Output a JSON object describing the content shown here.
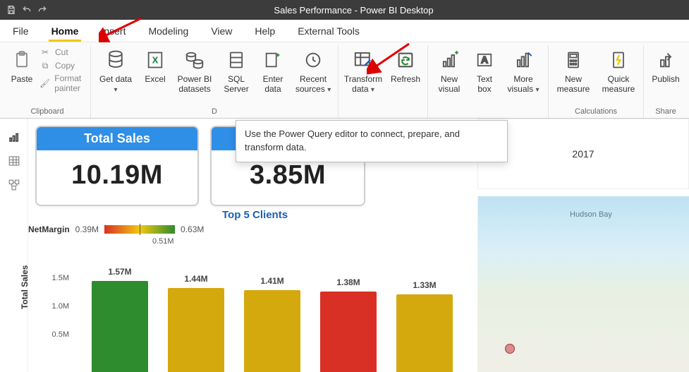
{
  "titlebar": {
    "title": "Sales Performance - Power BI Desktop"
  },
  "tabs": {
    "file": "File",
    "home": "Home",
    "insert": "Insert",
    "modeling": "Modeling",
    "view": "View",
    "help": "Help",
    "external": "External Tools"
  },
  "clipboard": {
    "paste": "Paste",
    "cut": "Cut",
    "copy": "Copy",
    "format_painter": "Format painter",
    "group": "Clipboard"
  },
  "data_group": {
    "get_data": "Get data",
    "excel": "Excel",
    "pbi_datasets": "Power BI datasets",
    "sql": "SQL Server",
    "enter": "Enter data",
    "recent": "Recent sources"
  },
  "queries": {
    "transform": "Transform data",
    "refresh": "Refresh"
  },
  "insert_group": {
    "new_visual": "New visual",
    "text_box": "Text box",
    "more_visuals": "More visuals"
  },
  "calculations": {
    "new_measure": "New measure",
    "quick_measure": "Quick measure",
    "group": "Calculations"
  },
  "share": {
    "publish": "Publish",
    "group": "Share"
  },
  "tooltip": {
    "text": "Use the Power Query editor to connect, prepare, and transform data."
  },
  "slicer": {
    "year": "2017"
  },
  "cards": {
    "c1": {
      "title": "Total Sales",
      "value": "10.19M"
    },
    "c2": {
      "title": "",
      "value": "3.85M"
    }
  },
  "top5": "Top 5 Clients",
  "legend": {
    "field": "NetMargin",
    "min": "0.39M",
    "mid": "0.51M",
    "max": "0.63M"
  },
  "map": {
    "label": "Hudson Bay"
  },
  "chart_data": {
    "type": "bar",
    "title": "",
    "xlabel": "",
    "ylabel": "Total Sales",
    "ylim": [
      0,
      1.7
    ],
    "y_ticks": [
      "1.5M",
      "1.0M",
      "0.5M"
    ],
    "bars": [
      {
        "label": "1.57M",
        "value": 1.57,
        "color": "#2e8b2e"
      },
      {
        "label": "1.44M",
        "value": 1.44,
        "color": "#d4a90d"
      },
      {
        "label": "1.41M",
        "value": 1.41,
        "color": "#d4a90d"
      },
      {
        "label": "1.38M",
        "value": 1.38,
        "color": "#d93025"
      },
      {
        "label": "1.33M",
        "value": 1.33,
        "color": "#d4a90d"
      }
    ]
  }
}
